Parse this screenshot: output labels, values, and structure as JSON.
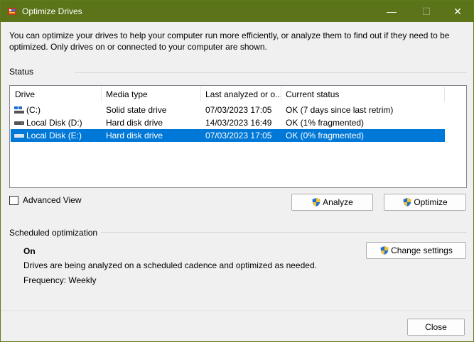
{
  "window": {
    "title": "Optimize Drives",
    "minimize_glyph": "—",
    "maximize_glyph": "☐",
    "close_glyph": "✕"
  },
  "intro": "You can optimize your drives to help your computer run more efficiently, or analyze them to find out if they need to be optimized. Only drives on or connected to your computer are shown.",
  "status": {
    "label": "Status",
    "columns": [
      "Drive",
      "Media type",
      "Last analyzed or o...",
      "Current status"
    ],
    "rows": [
      {
        "drive": "(C:)",
        "media": "Solid state drive",
        "last": "07/03/2023 17:05",
        "status": "OK (7 days since last retrim)",
        "icon": "windows-drive-icon"
      },
      {
        "drive": "Local Disk (D:)",
        "media": "Hard disk drive",
        "last": "14/03/2023 16:49",
        "status": "OK (1% fragmented)",
        "icon": "hard-disk-icon"
      },
      {
        "drive": "Local Disk (E:)",
        "media": "Hard disk drive",
        "last": "07/03/2023 17:05",
        "status": "OK (0% fragmented)",
        "icon": "hard-disk-icon"
      }
    ],
    "selected_row": 2,
    "advanced_view_label": "Advanced View",
    "advanced_view_checked": false,
    "analyze_label": "Analyze",
    "optimize_label": "Optimize"
  },
  "scheduled": {
    "label": "Scheduled optimization",
    "state": "On",
    "description": "Drives are being analyzed on a scheduled cadence and optimized as needed.",
    "frequency": "Frequency: Weekly",
    "change_settings_label": "Change settings"
  },
  "footer": {
    "close_label": "Close"
  },
  "colors": {
    "titlebar": "#5b7419",
    "selection": "#0078d7",
    "shield_blue": "#1f6fd1",
    "shield_yellow": "#f2c230"
  }
}
